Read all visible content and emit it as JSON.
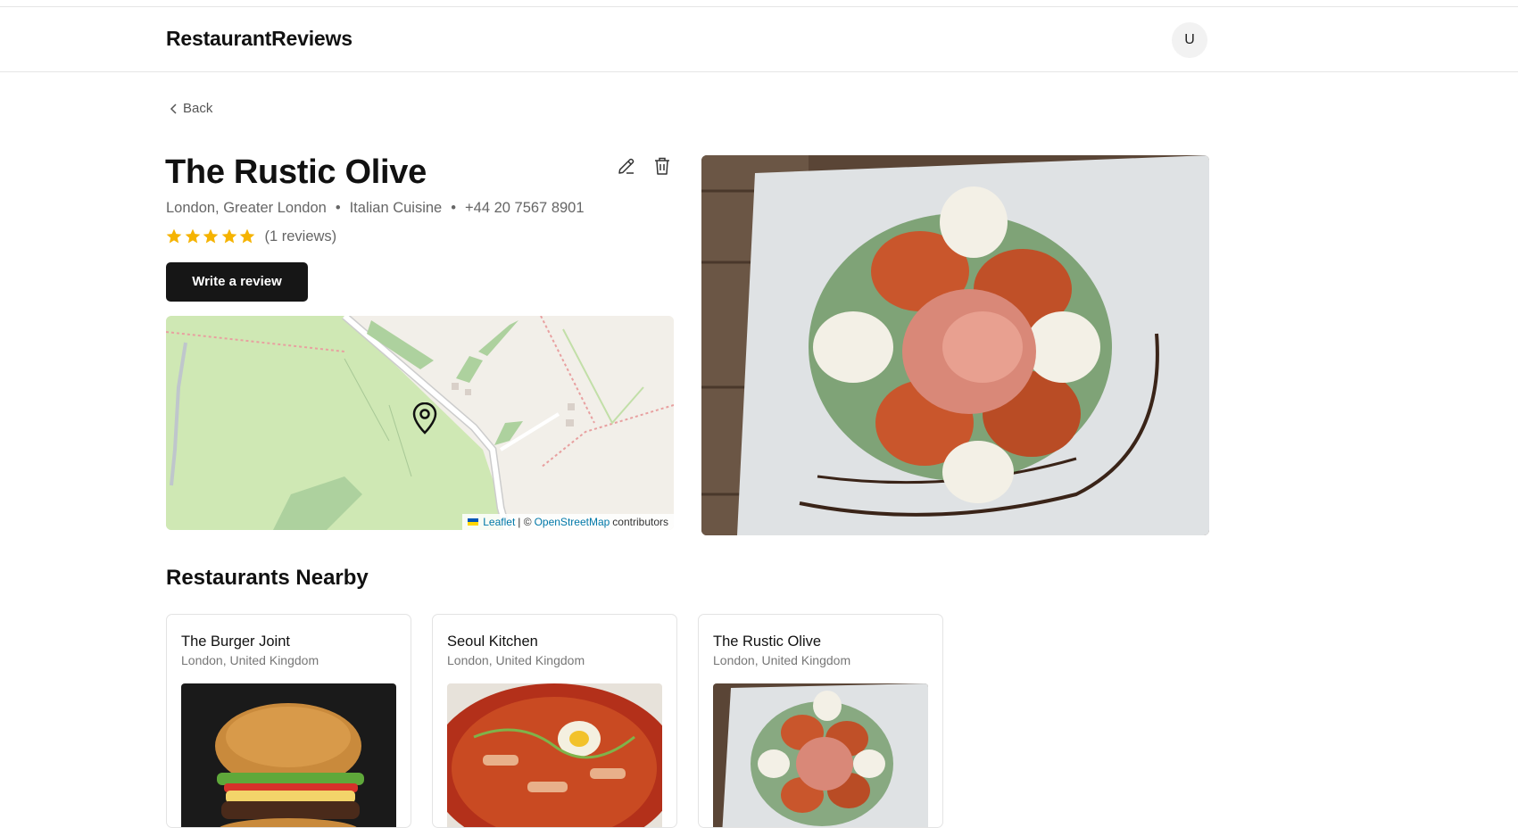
{
  "header": {
    "brand": "RestaurantReviews",
    "avatar_initial": "U"
  },
  "nav": {
    "back_label": "Back"
  },
  "restaurant": {
    "name": "The Rustic Olive",
    "location": "London, Greater London",
    "separator": "•",
    "cuisine": "Italian Cuisine",
    "phone": "+44 20 7567 8901",
    "rating": 5,
    "rating_max": 5,
    "reviews_text": "(1 reviews)",
    "write_review_label": "Write a review",
    "edit_icon": "pencil-icon",
    "delete_icon": "trash-icon"
  },
  "map": {
    "attribution_leaflet": "Leaflet",
    "attribution_sep": "| ©",
    "attribution_osm": "OpenStreetMap",
    "attribution_suffix": "contributors",
    "marker_icon": "map-pin-icon"
  },
  "nearby": {
    "title": "Restaurants Nearby",
    "items": [
      {
        "name": "The Burger Joint",
        "location": "London, United Kingdom"
      },
      {
        "name": "Seoul Kitchen",
        "location": "London, United Kingdom"
      },
      {
        "name": "The Rustic Olive",
        "location": "London, United Kingdom"
      }
    ]
  },
  "colors": {
    "star": "#f5b301",
    "button_bg": "#161616",
    "map_green": "#cfe8b4",
    "map_land": "#f2efe9"
  }
}
